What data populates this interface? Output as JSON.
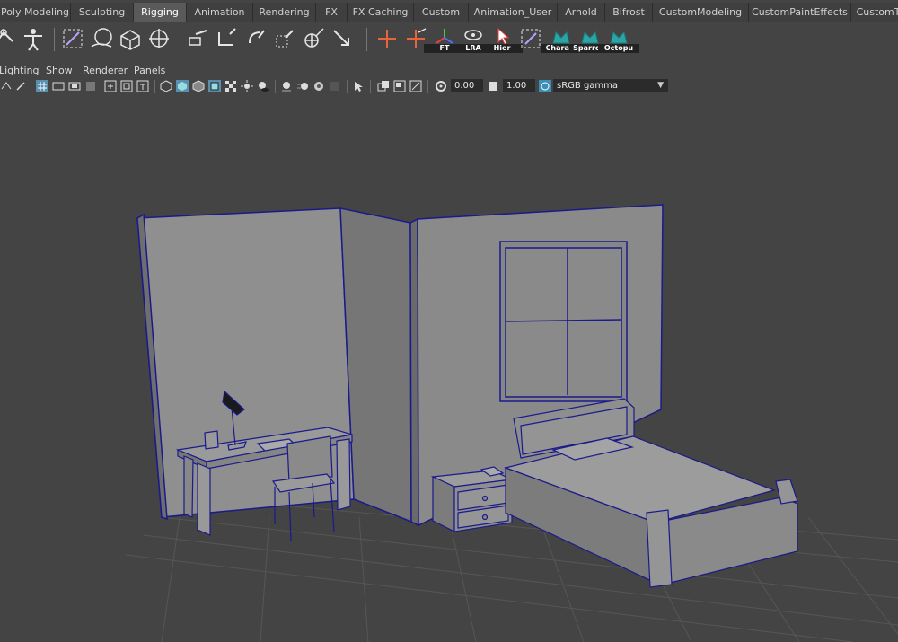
{
  "shelf_tabs": [
    {
      "label": "Poly Modeling",
      "active": false
    },
    {
      "label": "Sculpting",
      "active": false
    },
    {
      "label": "Rigging",
      "active": true
    },
    {
      "label": "Animation",
      "active": false
    },
    {
      "label": "Rendering",
      "active": false
    },
    {
      "label": "FX",
      "active": false
    },
    {
      "label": "FX Caching",
      "active": false
    },
    {
      "label": "Custom",
      "active": false
    },
    {
      "label": "Animation_User",
      "active": false
    },
    {
      "label": "Arnold",
      "active": false
    },
    {
      "label": "Bifrost",
      "active": false
    },
    {
      "label": "CustomModeling",
      "active": false
    },
    {
      "label": "CustomPaintEffects",
      "active": false
    },
    {
      "label": "CustomT",
      "active": false
    }
  ],
  "shelf": {
    "ft_label": "FT",
    "lra_label": "LRA",
    "hier_label": "Hier",
    "charact_label": "Charact",
    "sparrow_label": "Sparrow",
    "octopus_label": "Octopu"
  },
  "panel_menu": [
    "Lighting",
    "Show",
    "Renderer",
    "Panels"
  ],
  "panel_toolbar": {
    "exposure": "0.00",
    "gamma": "1.00",
    "color_space": "sRGB gamma"
  },
  "colors": {
    "wireframe": "#1a1a8c",
    "surface": "#8e8e8e",
    "grid": "#5a5a5a",
    "background": "#444444",
    "accent_orange": "#e8643a",
    "accent_teal": "#2aa5a5"
  }
}
